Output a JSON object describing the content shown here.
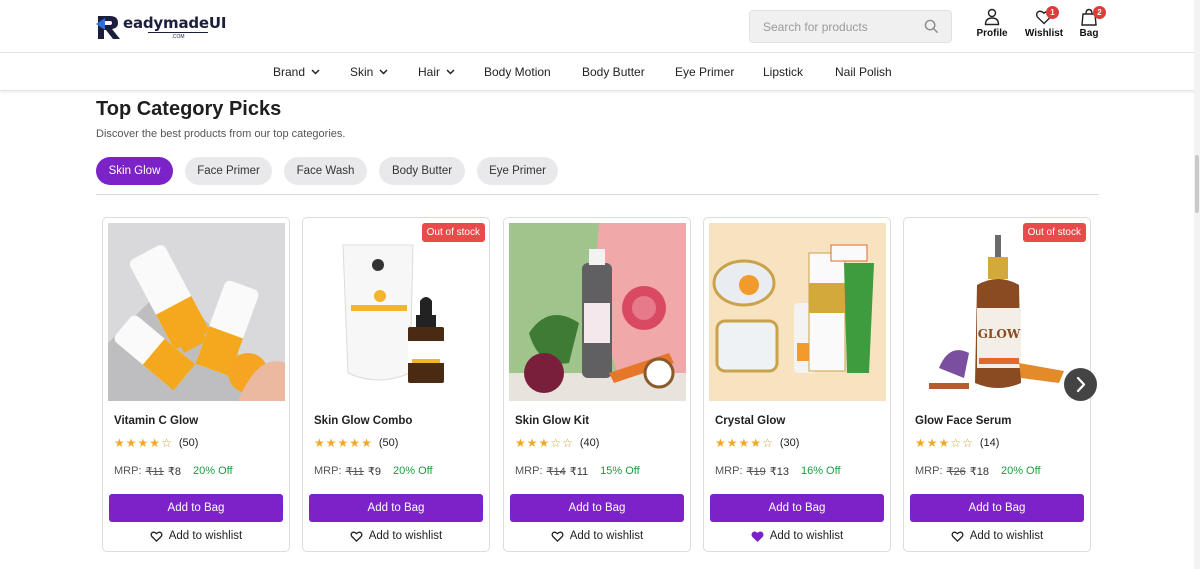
{
  "brand": {
    "name": "eadymadeUI",
    "sub": ".COM"
  },
  "search": {
    "placeholder": "Search for products"
  },
  "header_actions": {
    "profile": "Profile",
    "wishlist": "Wishlist",
    "wishlist_count": "1",
    "bag": "Bag",
    "bag_count": "2"
  },
  "nav": [
    {
      "label": "Brand",
      "dropdown": true
    },
    {
      "label": "Skin",
      "dropdown": true
    },
    {
      "label": "Hair",
      "dropdown": true
    },
    {
      "label": "Body Motion",
      "dropdown": false
    },
    {
      "label": "Body Butter",
      "dropdown": false
    },
    {
      "label": "Eye Primer",
      "dropdown": false
    },
    {
      "label": "Lipstick",
      "dropdown": false
    },
    {
      "label": "Nail Polish",
      "dropdown": false
    }
  ],
  "section": {
    "title": "Top Category Picks",
    "subtitle": "Discover the best products from our top categories."
  },
  "tabs": [
    {
      "label": "Skin Glow",
      "active": true
    },
    {
      "label": "Face Primer",
      "active": false
    },
    {
      "label": "Face Wash",
      "active": false
    },
    {
      "label": "Body Butter",
      "active": false
    },
    {
      "label": "Eye Primer",
      "active": false
    }
  ],
  "products": [
    {
      "name": "Vitamin C Glow",
      "rating": 4,
      "reviews": "(50)",
      "mrp_label": "MRP:",
      "old_price": "₹11",
      "price": "₹8",
      "discount": "20% Off",
      "out_of_stock": false,
      "wishlisted": false,
      "add_label": "Add to Bag",
      "wish_label": "Add to wishlist"
    },
    {
      "name": "Skin Glow Combo",
      "rating": 5,
      "reviews": "(50)",
      "mrp_label": "MRP:",
      "old_price": "₹11",
      "price": "₹9",
      "discount": "20% Off",
      "out_of_stock": true,
      "wishlisted": false,
      "add_label": "Add to Bag",
      "wish_label": "Add to wishlist"
    },
    {
      "name": "Skin Glow Kit",
      "rating": 3,
      "reviews": "(40)",
      "mrp_label": "MRP:",
      "old_price": "₹14",
      "price": "₹11",
      "discount": "15% Off",
      "out_of_stock": false,
      "wishlisted": false,
      "add_label": "Add to Bag",
      "wish_label": "Add to wishlist"
    },
    {
      "name": "Crystal Glow",
      "rating": 4,
      "reviews": "(30)",
      "mrp_label": "MRP:",
      "old_price": "₹19",
      "price": "₹13",
      "discount": "16% Off",
      "out_of_stock": false,
      "wishlisted": true,
      "add_label": "Add to Bag",
      "wish_label": "Add to wishlist"
    },
    {
      "name": "Glow Face Serum",
      "rating": 3,
      "reviews": "(14)",
      "mrp_label": "MRP:",
      "old_price": "₹26",
      "price": "₹18",
      "discount": "20% Off",
      "out_of_stock": true,
      "wishlisted": false,
      "add_label": "Add to Bag",
      "wish_label": "Add to wishlist"
    }
  ],
  "badges": {
    "out_of_stock": "Out of stock"
  },
  "colors": {
    "accent": "#7c22c9",
    "discount": "#1e9a3c",
    "badge": "#e94b4b",
    "star": "#f0a828"
  }
}
